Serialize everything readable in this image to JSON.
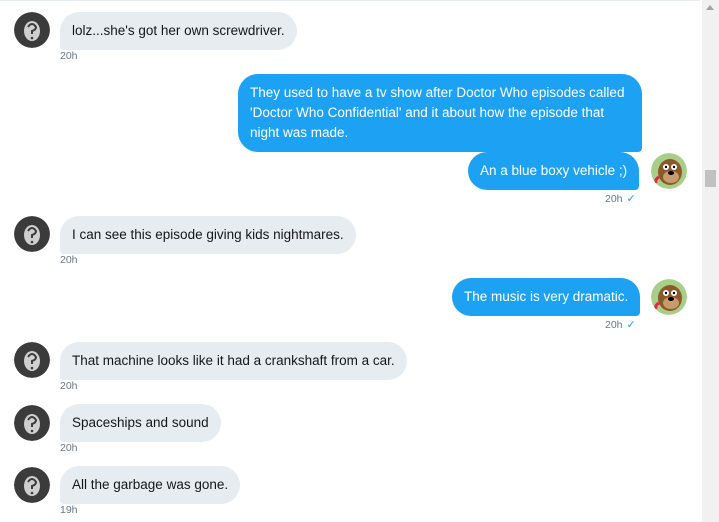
{
  "messages": [
    {
      "type": "in",
      "text": "lolz...she's got her own screwdriver.",
      "time": "20h"
    },
    {
      "type": "out",
      "text": "They used to have a tv show after Doctor Who episodes called 'Doctor Who Confidential' and it about how the episode that night was made."
    },
    {
      "type": "out",
      "text": "An a blue boxy vehicle ;)",
      "time": "20h",
      "status": "✓"
    },
    {
      "type": "in",
      "text": "I can see this episode giving kids nightmares.",
      "time": "20h"
    },
    {
      "type": "out",
      "text": "The music is very dramatic.",
      "time": "20h",
      "status": "✓"
    },
    {
      "type": "in",
      "text": "That machine looks like it had a crankshaft from a car.",
      "time": "20h"
    },
    {
      "type": "in",
      "text": "Spaceships and sound",
      "time": "20h"
    },
    {
      "type": "in",
      "text": "All the garbage was gone.",
      "time": "19h"
    }
  ],
  "icons": {
    "contact_avatar": "egg-silhouette-avatar",
    "own_avatar": "cartoon-dog-avatar",
    "read_receipt": "checkmark-icon",
    "scroll_up": "chevron-up-icon"
  },
  "colors": {
    "outgoing_bubble": "#1da1f2",
    "incoming_bubble": "#e6ecf0",
    "timestamp": "#657786",
    "read_check": "#1da1f2"
  }
}
